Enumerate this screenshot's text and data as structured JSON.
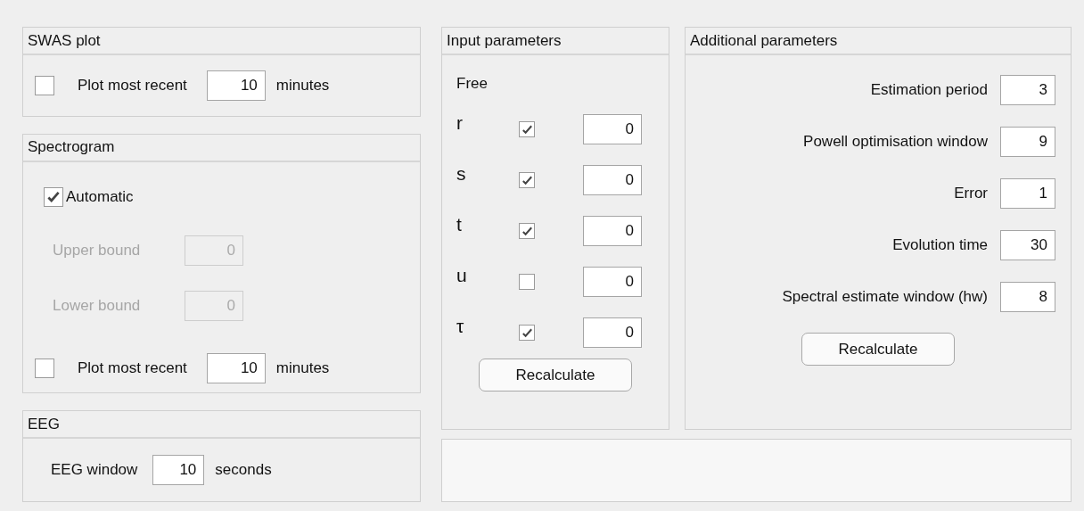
{
  "swas_plot": {
    "title": "SWAS plot",
    "plot_recent": {
      "checked": false,
      "label": "Plot most recent",
      "value": "10",
      "unit": "minutes"
    }
  },
  "spectrogram": {
    "title": "Spectrogram",
    "automatic": {
      "checked": true,
      "label": "Automatic"
    },
    "bounds": [
      {
        "label": "Upper bound",
        "value": "0",
        "disabled": true
      },
      {
        "label": "Lower bound",
        "value": "0",
        "disabled": true
      }
    ],
    "plot_recent": {
      "checked": false,
      "label": "Plot most recent",
      "value": "10",
      "unit": "minutes"
    }
  },
  "eeg": {
    "title": "EEG",
    "label": "EEG window",
    "value": "10",
    "unit": "seconds"
  },
  "input_parameters": {
    "title": "Input parameters",
    "free_label": "Free",
    "params": [
      {
        "name": "r",
        "free": true,
        "value": "0"
      },
      {
        "name": "s",
        "free": true,
        "value": "0"
      },
      {
        "name": "t",
        "free": true,
        "value": "0"
      },
      {
        "name": "u",
        "free": false,
        "value": "0"
      },
      {
        "name": "τ",
        "free": true,
        "value": "0"
      }
    ],
    "button": "Recalculate"
  },
  "additional_parameters": {
    "title": "Additional parameters",
    "fields": [
      {
        "label": "Estimation period",
        "value": "3"
      },
      {
        "label": "Powell optimisation window",
        "value": "9"
      },
      {
        "label": "Error",
        "value": "1"
      },
      {
        "label": "Evolution time",
        "value": "30"
      },
      {
        "label": "Spectral estimate window (hw)",
        "value": "8"
      }
    ],
    "button": "Recalculate"
  }
}
